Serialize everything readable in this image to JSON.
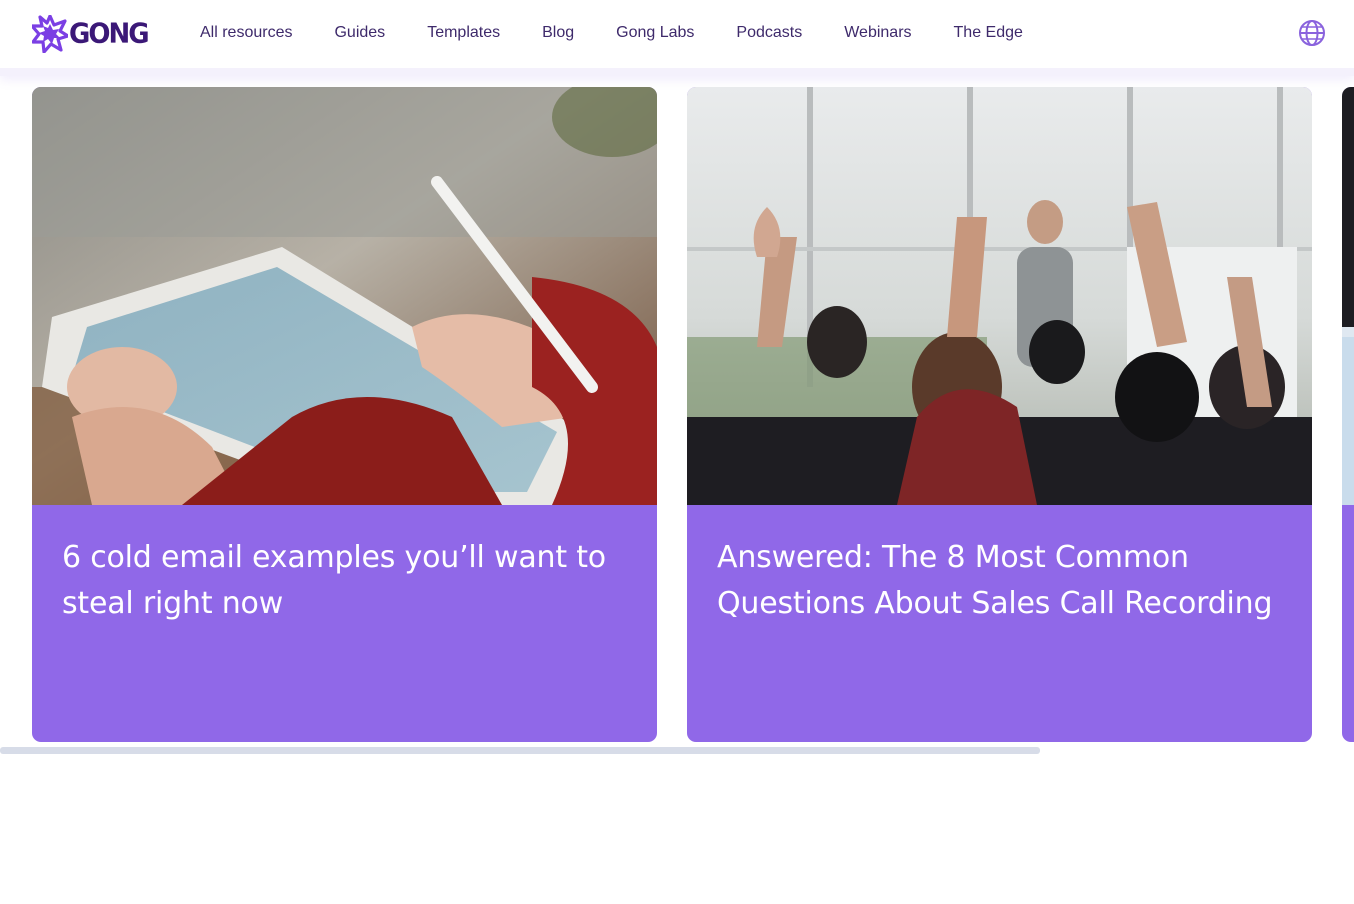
{
  "brand": {
    "name": "GONG",
    "accent_color": "#7b3fe4",
    "logo_icon": "gong-starburst-icon"
  },
  "nav": {
    "items": [
      {
        "label": "All resources"
      },
      {
        "label": "Guides"
      },
      {
        "label": "Templates"
      },
      {
        "label": "Blog"
      },
      {
        "label": "Gong Labs"
      },
      {
        "label": "Podcasts"
      },
      {
        "label": "Webinars"
      },
      {
        "label": "The Edge"
      }
    ],
    "language_icon": "globe-icon"
  },
  "cards": [
    {
      "title": "6 cold email examples you’ll want to steal right now",
      "image": "hands-writing-on-tablet-photo",
      "bg_color": "#9068e8"
    },
    {
      "title": "Answered: The 8 Most Common Questions About Sales Call Recording",
      "image": "audience-raising-hands-photo",
      "bg_color": "#9068e8"
    }
  ],
  "scrollbar": {
    "position_fraction": 0.77
  }
}
